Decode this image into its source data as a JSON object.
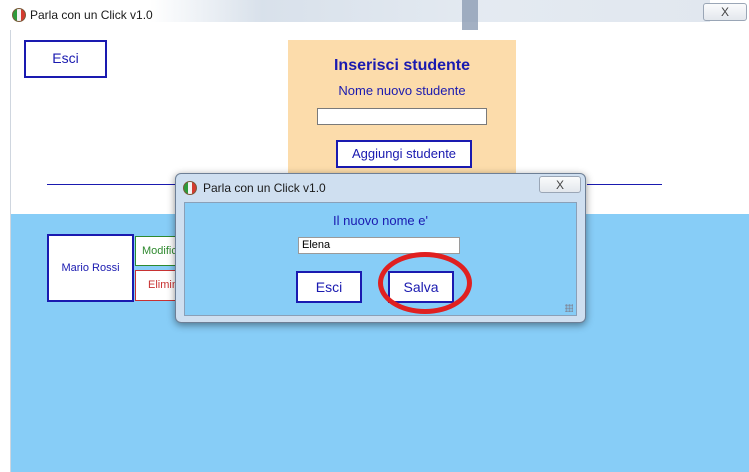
{
  "main_window": {
    "title": "Parla con un Click v1.0",
    "close_glyph": "X"
  },
  "left_panel": {
    "exit_label": "Esci"
  },
  "insert_panel": {
    "title": "Inserisci studente",
    "subtitle": "Nome nuovo studente",
    "name_value": "",
    "add_button_label": "Aggiungi studente"
  },
  "students": [
    {
      "name": "Mario Rossi",
      "edit_label": "Modifica",
      "delete_label": "Elimina"
    }
  ],
  "dialog": {
    "title": "Parla con un Click v1.0",
    "close_glyph": "X",
    "prompt": "Il nuovo nome e'",
    "name_value": "Elena",
    "exit_label": "Esci",
    "save_label": "Salva"
  },
  "icons": {
    "app": "app-flag-icon",
    "resize": "resize-grip-icon"
  },
  "colors": {
    "accent_blue": "#1a1ab0",
    "panel_orange": "#fcdcab",
    "area_light_blue": "#87cdf7",
    "edit_green": "#2f8a2f",
    "delete_red": "#c83232",
    "highlight_red": "#e02020"
  }
}
